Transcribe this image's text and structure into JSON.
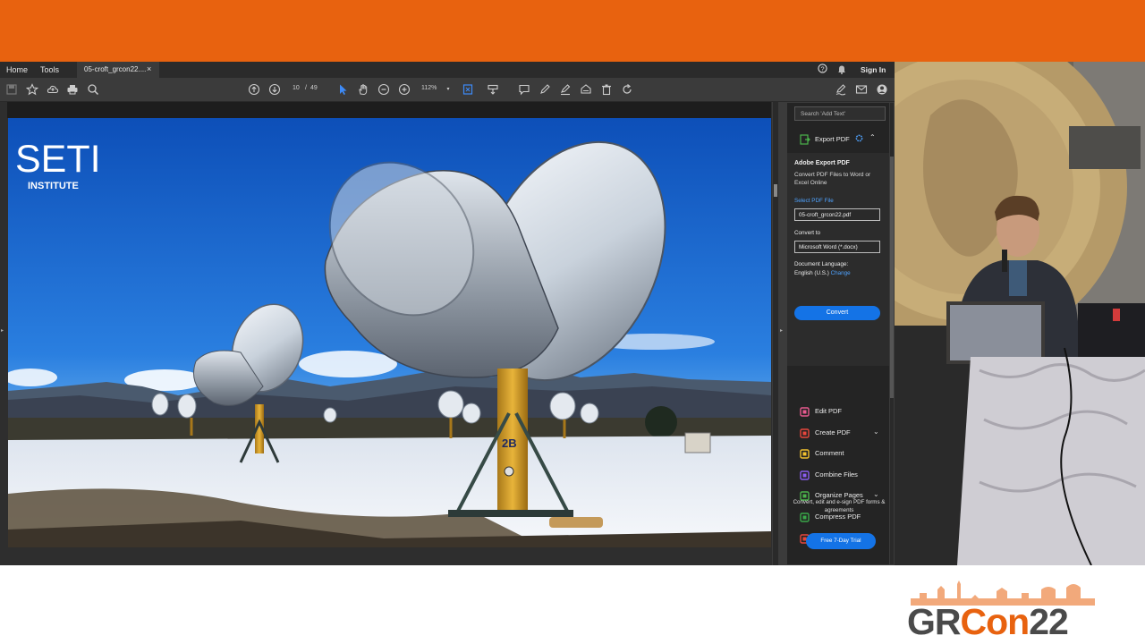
{
  "colors": {
    "brand_orange": "#e8620f",
    "acrobat_blue": "#1473e6",
    "link_blue": "#4fa3ff",
    "panel_bg": "#242424"
  },
  "tabs": {
    "home": "Home",
    "tools": "Tools",
    "document": "05-croft_grcon22....",
    "close": "×"
  },
  "header": {
    "sign_in": "Sign In"
  },
  "toolbar": {
    "page_current": "10",
    "page_separator": "/",
    "page_total": "49",
    "zoom": "112%",
    "icons": [
      "save-icon",
      "bookmark-star-icon",
      "upload-cloud-icon",
      "print-icon",
      "search-icon",
      "page-up-icon",
      "page-down-icon",
      "select-cursor-icon",
      "hand-icon",
      "zoom-out-icon",
      "zoom-in-icon",
      "fit-page-icon",
      "scroll-mode-icon",
      "comment-icon",
      "pen-icon",
      "highlight-icon",
      "stamp-icon",
      "delete-icon",
      "rotate-icon",
      "sign-icon",
      "email-icon",
      "share-icon"
    ]
  },
  "slide": {
    "logo_main": "SETI",
    "logo_sub": "INSTITUTE",
    "dish_label": "2B"
  },
  "right_pane": {
    "search_placeholder": "Search 'Add Text'",
    "export_label": "Export PDF",
    "export_title": "Adobe Export PDF",
    "export_description": "Convert PDF Files to Word or Excel Online",
    "select_file_label": "Select PDF File",
    "selected_file": "05-croft_grcon22.pdf",
    "convert_to_label": "Convert to",
    "convert_to_value": "Microsoft Word (*.docx)",
    "document_language_label": "Document Language:",
    "document_language_value": "English (U.S.)",
    "change_link": "Change",
    "convert_button": "Convert",
    "tools": [
      {
        "label": "Edit PDF",
        "icon": "edit-pdf-icon",
        "color": "#e85a8f"
      },
      {
        "label": "Create PDF",
        "icon": "create-pdf-icon",
        "color": "#e8463c"
      },
      {
        "label": "Comment",
        "icon": "comment-icon",
        "color": "#f2c12e"
      },
      {
        "label": "Combine Files",
        "icon": "combine-files-icon",
        "color": "#8a5cf0"
      },
      {
        "label": "Organize Pages",
        "icon": "organize-pages-icon",
        "color": "#4bb34b"
      },
      {
        "label": "Compress PDF",
        "icon": "compress-pdf-icon",
        "color": "#3aa84a"
      },
      {
        "label": "Redact",
        "icon": "redact-icon",
        "color": "#e8463c"
      }
    ],
    "promo_text": "Convert, edit and e-sign PDF forms & agreements",
    "trial_button": "Free 7-Day Trial"
  },
  "event": {
    "logo_gr": "GR",
    "logo_con": "Con",
    "logo_year": "22"
  }
}
